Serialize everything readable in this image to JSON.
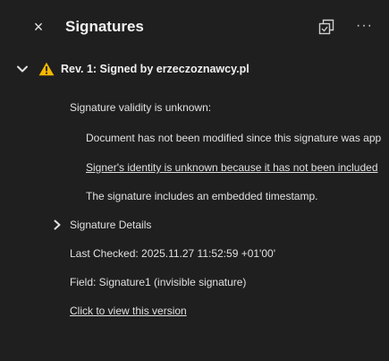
{
  "panel": {
    "title": "Signatures",
    "close_glyph": "×",
    "more_glyph": "···"
  },
  "revision": {
    "label": "Rev. 1: Signed by erzeczoznawcy.pl",
    "validity": "Signature validity is unknown:",
    "modified_status": "Document has not been modified since this signature was app",
    "identity_status": "Signer's identity is unknown because it has not been included",
    "timestamp_status": "The signature includes an embedded timestamp.",
    "details_label": "Signature Details",
    "last_checked": "Last Checked: 2025.11.27 11:52:59 +01'00'",
    "field": "Field: Signature1 (invisible signature)",
    "view_version_link": "Click to view this version"
  },
  "colors": {
    "background": "#1f1f1f",
    "text": "#e0e0e0",
    "warning": "#f5b800"
  },
  "icons": {
    "close": "close-icon",
    "options": "signature-options-icon",
    "more": "more-icon",
    "expand": "chevron-down-icon",
    "warning": "warning-icon",
    "collapsed": "chevron-right-icon"
  }
}
